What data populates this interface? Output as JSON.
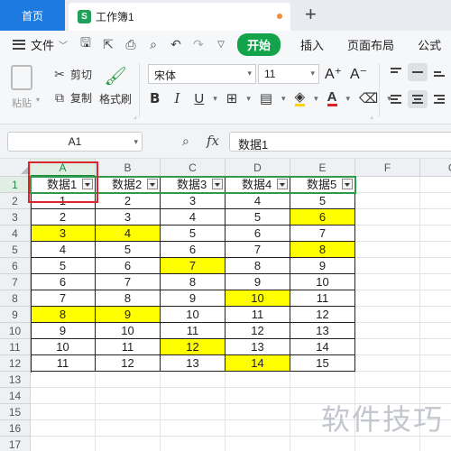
{
  "tabs": {
    "home": "首页",
    "document": "工作簿1",
    "doc_icon": "S",
    "add": "+"
  },
  "menu": {
    "file": "文件",
    "start": "开始",
    "insert": "插入",
    "page_layout": "页面布局",
    "formula": "公式"
  },
  "ribbon": {
    "paste": "粘贴",
    "cut": "剪切",
    "copy": "复制",
    "format_painter": "格式刷",
    "font_name": "宋体",
    "font_size": "11",
    "bold": "B",
    "italic": "I",
    "underline": "U",
    "grow_font": "A⁺",
    "shrink_font": "A⁻"
  },
  "formula_bar": {
    "cell_ref": "A1",
    "fx": "fx",
    "content": "数据1"
  },
  "sheet": {
    "columns": [
      "A",
      "B",
      "C",
      "D",
      "E",
      "F",
      "G"
    ],
    "rows": [
      "1",
      "2",
      "3",
      "4",
      "5",
      "6",
      "7",
      "8",
      "9",
      "10",
      "11",
      "12",
      "13",
      "14",
      "15",
      "16",
      "17"
    ],
    "headers": [
      "数据1",
      "数据2",
      "数据3",
      "数据4",
      "数据5"
    ],
    "data": [
      [
        "1",
        "2",
        "3",
        "4",
        "5"
      ],
      [
        "2",
        "3",
        "4",
        "5",
        "6"
      ],
      [
        "3",
        "4",
        "5",
        "6",
        "7"
      ],
      [
        "4",
        "5",
        "6",
        "7",
        "8"
      ],
      [
        "5",
        "6",
        "7",
        "8",
        "9"
      ],
      [
        "6",
        "7",
        "8",
        "9",
        "10"
      ],
      [
        "7",
        "8",
        "9",
        "10",
        "11"
      ],
      [
        "8",
        "9",
        "10",
        "11",
        "12"
      ],
      [
        "9",
        "10",
        "11",
        "12",
        "13"
      ],
      [
        "10",
        "11",
        "12",
        "13",
        "14"
      ],
      [
        "11",
        "12",
        "13",
        "14",
        "15"
      ]
    ],
    "highlighted": [
      [
        1,
        4
      ],
      [
        2,
        0
      ],
      [
        2,
        1
      ],
      [
        3,
        4
      ],
      [
        4,
        2
      ],
      [
        6,
        3
      ],
      [
        7,
        0
      ],
      [
        7,
        1
      ],
      [
        9,
        2
      ],
      [
        10,
        3
      ]
    ],
    "highlight_color": "#ffff00"
  },
  "colors": {
    "accent_green": "#13a34b",
    "home_tab_blue": "#1d7ae0",
    "annotation_red": "#d9262c"
  },
  "watermark": "软件技巧"
}
